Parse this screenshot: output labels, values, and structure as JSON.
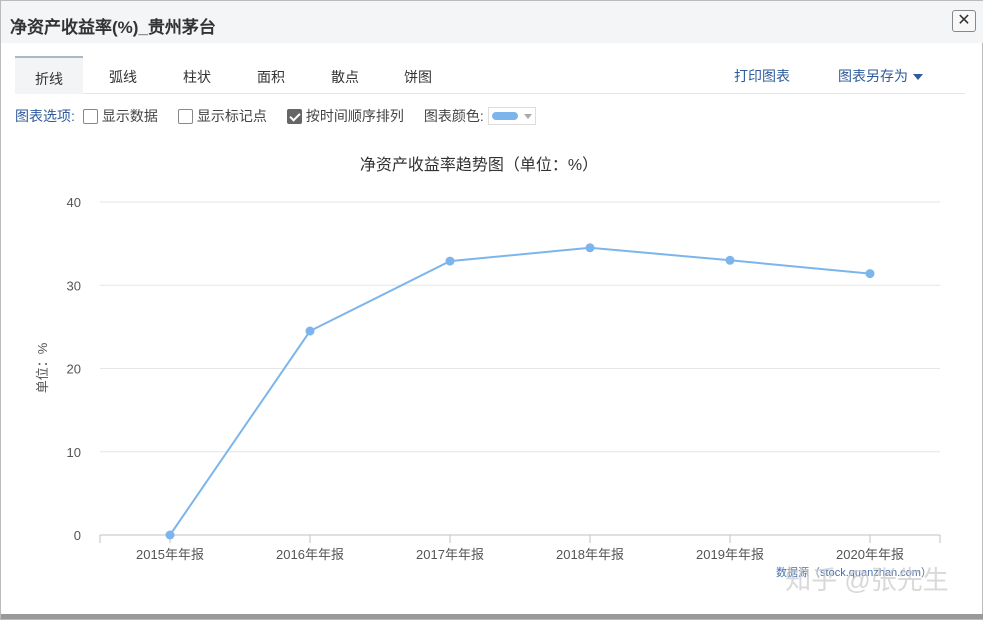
{
  "window": {
    "title": "净资产收益率(%)_贵州茅台",
    "close": "✕"
  },
  "tabs": [
    "折线",
    "弧线",
    "柱状",
    "面积",
    "散点",
    "饼图"
  ],
  "actions": {
    "print": "打印图表",
    "save_as": "图表另存为"
  },
  "options": {
    "label": "图表选项:",
    "show_data": "显示数据",
    "show_markers": "显示标记点",
    "sort_by_time": "按时间顺序排列",
    "color_label": "图表颜色:",
    "show_data_checked": false,
    "show_markers_checked": false,
    "sort_by_time_checked": true,
    "color": "#7cb5ec"
  },
  "chart_data": {
    "type": "line",
    "title": "净资产收益率趋势图（单位：%）",
    "ylabel": "单位：%",
    "xlabel": "",
    "categories": [
      "2015年年报",
      "2016年年报",
      "2017年年报",
      "2018年年报",
      "2019年年报",
      "2020年年报"
    ],
    "series": [
      {
        "name": "净资产收益率",
        "values": [
          0,
          24.5,
          32.9,
          34.5,
          33.0,
          31.4
        ],
        "color": "#7cb5ec"
      }
    ],
    "ylim": [
      0,
      40
    ],
    "yticks": [
      0,
      10,
      20,
      30,
      40
    ],
    "grid": true,
    "credit": "数据源（stock.quanzhan.com）"
  },
  "watermark": "知乎 @张先生"
}
